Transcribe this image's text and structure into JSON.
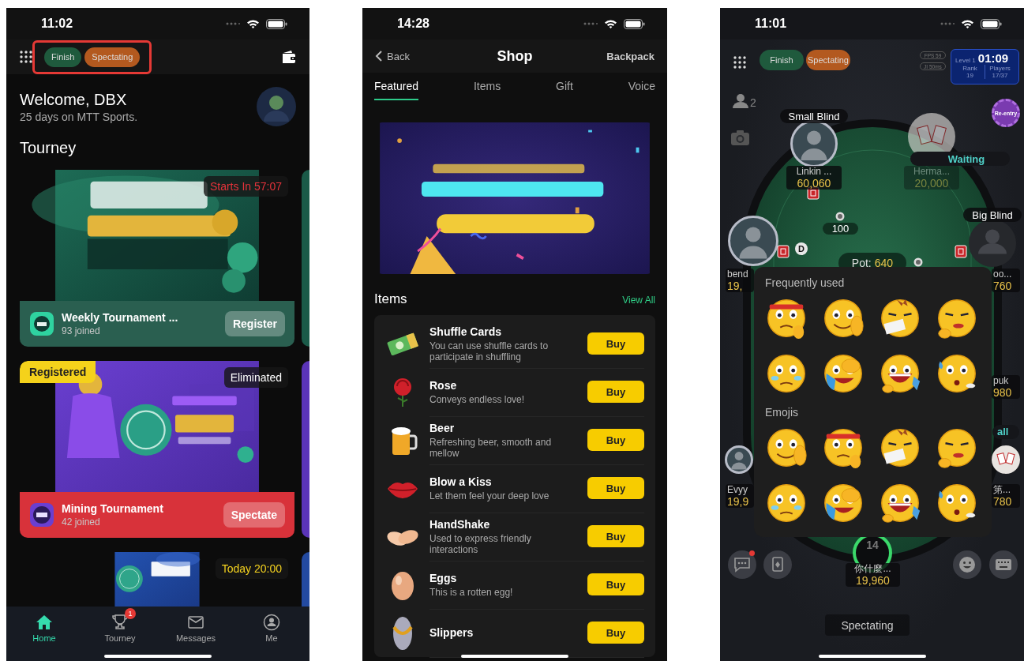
{
  "home_screen": {
    "status_bar": {
      "time": "11:02"
    },
    "header": {
      "highlighted": true,
      "chips": [
        {
          "label": "Finish",
          "kind": "finish"
        },
        {
          "label": "Spectating",
          "kind": "spectating"
        }
      ]
    },
    "welcome": {
      "title": "Welcome, DBX",
      "subtitle": "25 days on MTT Sports."
    },
    "section_title": "Tourney",
    "tournaments": [
      {
        "badge": {
          "text": "Starts In 57:07",
          "kind": "countdown"
        },
        "color": "#2a5f50",
        "name": "Weekly Tournament ...",
        "joined": "93 joined",
        "action": "Register"
      },
      {
        "tag": "Registered",
        "badge": {
          "text": "Eliminated",
          "kind": "result"
        },
        "color": "#d8323a",
        "name": "Mining Tournament",
        "joined": "42 joined",
        "action": "Spectate"
      },
      {
        "badge": {
          "text": "Today 20:00",
          "kind": "schedule"
        }
      }
    ],
    "tab_bar": [
      {
        "label": "Home",
        "selected": true
      },
      {
        "label": "Tourney",
        "selected": false,
        "badge": "1"
      },
      {
        "label": "Messages",
        "selected": false
      },
      {
        "label": "Me",
        "selected": false
      }
    ]
  },
  "shop_screen": {
    "status_bar": {
      "time": "14:28"
    },
    "nav": {
      "back": "Back",
      "title": "Shop",
      "action": "Backpack"
    },
    "tabs": [
      {
        "label": "Featured",
        "selected": true
      },
      {
        "label": "Items",
        "selected": false
      },
      {
        "label": "Gift",
        "selected": false
      },
      {
        "label": "Voice",
        "selected": false
      }
    ],
    "section": {
      "title": "Items",
      "link": "View All"
    },
    "items": [
      {
        "name": "Shuffle Cards",
        "description": "You can use shuffle cards to participate in shuffling",
        "button": "Buy"
      },
      {
        "name": "Rose",
        "description": "Conveys endless love!",
        "button": "Buy"
      },
      {
        "name": "Beer",
        "description": "Refreshing beer, smooth and mellow",
        "button": "Buy"
      },
      {
        "name": "Blow a Kiss",
        "description": "Let them feel your deep love",
        "button": "Buy"
      },
      {
        "name": "HandShake",
        "description": "Used to express friendly interactions",
        "button": "Buy"
      },
      {
        "name": "Eggs",
        "description": "This is a rotten egg!",
        "button": "Buy"
      },
      {
        "name": "Slippers",
        "button": "Buy"
      }
    ]
  },
  "table_screen": {
    "status_bar": {
      "time": "11:01"
    },
    "chips": [
      {
        "label": "Finish",
        "kind": "finish"
      },
      {
        "label": "Spectating",
        "kind": "spectating"
      }
    ],
    "network_stats": [
      "FPS 59",
      "JI 50ms"
    ],
    "level_panel": {
      "stage": "Level 1",
      "timer": "01:09",
      "rank_label": "Rank",
      "rank": "19",
      "players_label": "Players",
      "players": "17/37"
    },
    "viewers": "2",
    "reentry": "Re-entry",
    "seats": [
      {
        "tag": {
          "text": "Small Blind",
          "kind": "blind"
        },
        "name": "Linkin ...",
        "stack": "60,060"
      },
      {
        "tag": {
          "text": "Waiting",
          "kind": "status"
        },
        "avatar": {
          "kind": "cards"
        },
        "name": "Herma...",
        "stack": "20,000",
        "waiting": true
      },
      {
        "name": "bend",
        "stack": "19,",
        "dealer": true
      },
      {
        "tag": {
          "text": "Big Blind",
          "kind": "blind"
        },
        "avatar": {
          "kind": "empty"
        },
        "name": "oo...",
        "stack": "760"
      },
      {
        "name": "puk",
        "stack": "980"
      },
      {
        "name": "Evyy",
        "stack": "19,9"
      },
      {
        "tag": {
          "text": "all",
          "kind": "status"
        },
        "avatar": {
          "kind": "cards"
        },
        "name": "第...",
        "stack": "780"
      },
      {
        "avatar": {
          "kind": "timer"
        },
        "timer": "14",
        "name": "你什麼...",
        "stack": "19,960"
      }
    ],
    "dealer_button": "D",
    "bet": "100",
    "pot": {
      "label": "Pot:",
      "value": "640"
    },
    "emoji_panel": {
      "sections": [
        {
          "title": "Frequently used"
        },
        {
          "title": "Emojis"
        }
      ]
    },
    "controls": [
      {
        "kind": "chat",
        "unread": true
      },
      {
        "kind": "cards",
        "unread": false
      },
      {
        "kind": "emoji",
        "unread": false
      },
      {
        "kind": "keyboard",
        "unread": false
      }
    ],
    "mode_label": "Spectating"
  }
}
